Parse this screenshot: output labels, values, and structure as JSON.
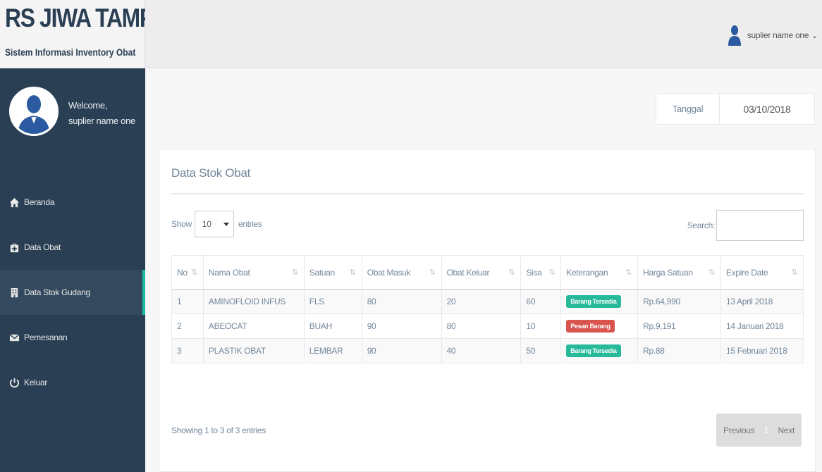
{
  "brand": {
    "title": "RS JIWA TAMPAN",
    "subtitle": "Sistem Informasi Inventory Obat"
  },
  "profile": {
    "welcome": "Welcome,",
    "name": "suplier name one"
  },
  "menu": [
    {
      "label": "Beranda",
      "icon": "home-icon"
    },
    {
      "label": "Data Obat",
      "icon": "medkit-icon"
    },
    {
      "label": "Data Stok Gudang",
      "icon": "building-icon"
    },
    {
      "label": "Pemesanan",
      "icon": "envelope-icon"
    },
    {
      "label": "Keluar",
      "icon": "power-icon"
    }
  ],
  "topnav": {
    "user": "suplier name one",
    "chevron": "chevron-down-icon"
  },
  "date": {
    "label": "Tanggal",
    "value": "03/10/2018"
  },
  "panel": {
    "title": "Data Stok Obat",
    "show_label": "Show",
    "entries_value": "10",
    "entries_label": "entries",
    "search_label": "Search:",
    "search_value": ""
  },
  "table": {
    "headers": [
      "No",
      "Nama Obat",
      "Satuan",
      "Obat Masuk",
      "Obat Keluar",
      "Sisa",
      "Keterangan",
      "Harga Satuan",
      "Expire Date"
    ],
    "rows": [
      {
        "no": "1",
        "nama": "AMINOFLOID INFUS",
        "satuan": "FLS",
        "masuk": "80",
        "keluar": "20",
        "sisa": "60",
        "ket": "Barang Tersedia",
        "ket_color": "green",
        "harga": "Rp.64,990",
        "expire": "13 April 2018"
      },
      {
        "no": "2",
        "nama": "ABEOCAT",
        "satuan": "BUAH",
        "masuk": "90",
        "keluar": "80",
        "sisa": "10",
        "ket": "Pesan Barang",
        "ket_color": "red",
        "harga": "Rp.9,191",
        "expire": "14 Januari 2018"
      },
      {
        "no": "3",
        "nama": "PLASTIK OBAT",
        "satuan": "LEMBAR",
        "masuk": "90",
        "keluar": "40",
        "sisa": "50",
        "ket": "Barang Tersedia",
        "ket_color": "green",
        "harga": "Rp.88",
        "expire": "15 Februari 2018"
      }
    ]
  },
  "footer": {
    "info": "Showing 1 to 3 of 3 entries",
    "previous": "Previous",
    "current": "1",
    "next": "Next"
  },
  "colors": {
    "sidebar": "#2a3f54",
    "accent": "#1abb9c",
    "success": "#26b99a",
    "danger": "#d9534f"
  }
}
